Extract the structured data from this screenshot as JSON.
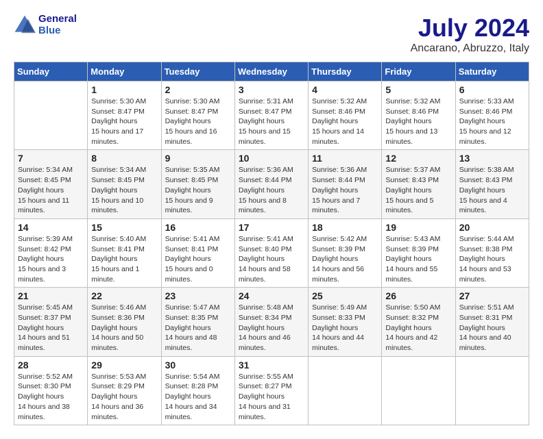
{
  "header": {
    "logo_line1": "General",
    "logo_line2": "Blue",
    "month": "July 2024",
    "location": "Ancarano, Abruzzo, Italy"
  },
  "weekdays": [
    "Sunday",
    "Monday",
    "Tuesday",
    "Wednesday",
    "Thursday",
    "Friday",
    "Saturday"
  ],
  "weeks": [
    [
      {
        "day": "",
        "empty": true
      },
      {
        "day": "1",
        "sunrise": "5:30 AM",
        "sunset": "8:47 PM",
        "daylight": "15 hours and 17 minutes."
      },
      {
        "day": "2",
        "sunrise": "5:30 AM",
        "sunset": "8:47 PM",
        "daylight": "15 hours and 16 minutes."
      },
      {
        "day": "3",
        "sunrise": "5:31 AM",
        "sunset": "8:47 PM",
        "daylight": "15 hours and 15 minutes."
      },
      {
        "day": "4",
        "sunrise": "5:32 AM",
        "sunset": "8:46 PM",
        "daylight": "15 hours and 14 minutes."
      },
      {
        "day": "5",
        "sunrise": "5:32 AM",
        "sunset": "8:46 PM",
        "daylight": "15 hours and 13 minutes."
      },
      {
        "day": "6",
        "sunrise": "5:33 AM",
        "sunset": "8:46 PM",
        "daylight": "15 hours and 12 minutes."
      }
    ],
    [
      {
        "day": "7",
        "sunrise": "5:34 AM",
        "sunset": "8:45 PM",
        "daylight": "15 hours and 11 minutes."
      },
      {
        "day": "8",
        "sunrise": "5:34 AM",
        "sunset": "8:45 PM",
        "daylight": "15 hours and 10 minutes."
      },
      {
        "day": "9",
        "sunrise": "5:35 AM",
        "sunset": "8:45 PM",
        "daylight": "15 hours and 9 minutes."
      },
      {
        "day": "10",
        "sunrise": "5:36 AM",
        "sunset": "8:44 PM",
        "daylight": "15 hours and 8 minutes."
      },
      {
        "day": "11",
        "sunrise": "5:36 AM",
        "sunset": "8:44 PM",
        "daylight": "15 hours and 7 minutes."
      },
      {
        "day": "12",
        "sunrise": "5:37 AM",
        "sunset": "8:43 PM",
        "daylight": "15 hours and 5 minutes."
      },
      {
        "day": "13",
        "sunrise": "5:38 AM",
        "sunset": "8:43 PM",
        "daylight": "15 hours and 4 minutes."
      }
    ],
    [
      {
        "day": "14",
        "sunrise": "5:39 AM",
        "sunset": "8:42 PM",
        "daylight": "15 hours and 3 minutes."
      },
      {
        "day": "15",
        "sunrise": "5:40 AM",
        "sunset": "8:41 PM",
        "daylight": "15 hours and 1 minute."
      },
      {
        "day": "16",
        "sunrise": "5:41 AM",
        "sunset": "8:41 PM",
        "daylight": "15 hours and 0 minutes."
      },
      {
        "day": "17",
        "sunrise": "5:41 AM",
        "sunset": "8:40 PM",
        "daylight": "14 hours and 58 minutes."
      },
      {
        "day": "18",
        "sunrise": "5:42 AM",
        "sunset": "8:39 PM",
        "daylight": "14 hours and 56 minutes."
      },
      {
        "day": "19",
        "sunrise": "5:43 AM",
        "sunset": "8:39 PM",
        "daylight": "14 hours and 55 minutes."
      },
      {
        "day": "20",
        "sunrise": "5:44 AM",
        "sunset": "8:38 PM",
        "daylight": "14 hours and 53 minutes."
      }
    ],
    [
      {
        "day": "21",
        "sunrise": "5:45 AM",
        "sunset": "8:37 PM",
        "daylight": "14 hours and 51 minutes."
      },
      {
        "day": "22",
        "sunrise": "5:46 AM",
        "sunset": "8:36 PM",
        "daylight": "14 hours and 50 minutes."
      },
      {
        "day": "23",
        "sunrise": "5:47 AM",
        "sunset": "8:35 PM",
        "daylight": "14 hours and 48 minutes."
      },
      {
        "day": "24",
        "sunrise": "5:48 AM",
        "sunset": "8:34 PM",
        "daylight": "14 hours and 46 minutes."
      },
      {
        "day": "25",
        "sunrise": "5:49 AM",
        "sunset": "8:33 PM",
        "daylight": "14 hours and 44 minutes."
      },
      {
        "day": "26",
        "sunrise": "5:50 AM",
        "sunset": "8:32 PM",
        "daylight": "14 hours and 42 minutes."
      },
      {
        "day": "27",
        "sunrise": "5:51 AM",
        "sunset": "8:31 PM",
        "daylight": "14 hours and 40 minutes."
      }
    ],
    [
      {
        "day": "28",
        "sunrise": "5:52 AM",
        "sunset": "8:30 PM",
        "daylight": "14 hours and 38 minutes."
      },
      {
        "day": "29",
        "sunrise": "5:53 AM",
        "sunset": "8:29 PM",
        "daylight": "14 hours and 36 minutes."
      },
      {
        "day": "30",
        "sunrise": "5:54 AM",
        "sunset": "8:28 PM",
        "daylight": "14 hours and 34 minutes."
      },
      {
        "day": "31",
        "sunrise": "5:55 AM",
        "sunset": "8:27 PM",
        "daylight": "14 hours and 31 minutes."
      },
      {
        "day": "",
        "empty": true
      },
      {
        "day": "",
        "empty": true
      },
      {
        "day": "",
        "empty": true
      }
    ]
  ]
}
